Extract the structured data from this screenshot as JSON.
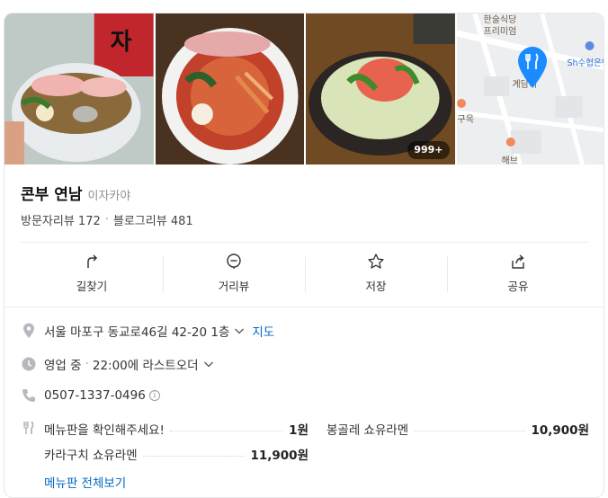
{
  "photos": {
    "badge": "999+",
    "map_labels": [
      "한술식당",
      "프리미엄",
      "Sh수협은행",
      "계담디",
      "구옥",
      "해브"
    ],
    "accent": "#1a8cff"
  },
  "place": {
    "name": "콘부 연남",
    "category": "이자카야",
    "visitor_reviews": "방문자리뷰 172",
    "separator": "·",
    "blog_reviews": "블로그리뷰 481"
  },
  "actions": [
    {
      "label": "길찾기",
      "icon": "directions-icon"
    },
    {
      "label": "거리뷰",
      "icon": "street-view-icon"
    },
    {
      "label": "저장",
      "icon": "star-icon"
    },
    {
      "label": "공유",
      "icon": "share-icon"
    }
  ],
  "info": {
    "address": "서울 마포구 동교로46길 42-20 1층",
    "map_link": "지도",
    "status": "영업 중",
    "status_separator": "·",
    "last_order": "22:00에 라스트오더",
    "phone": "0507-1337-0496",
    "phone_info": "i"
  },
  "menu": {
    "items": [
      {
        "name": "메뉴판을 확인해주세요!",
        "price": "1원"
      },
      {
        "name": "봉골레 쇼유라멘",
        "price": "10,900원"
      },
      {
        "name": "카라구치 쇼유라멘",
        "price": "11,900원"
      }
    ],
    "view_all": "메뉴판 전체보기"
  },
  "colors": {
    "link": "#0068c3",
    "map_pin": "#1a8cff"
  }
}
